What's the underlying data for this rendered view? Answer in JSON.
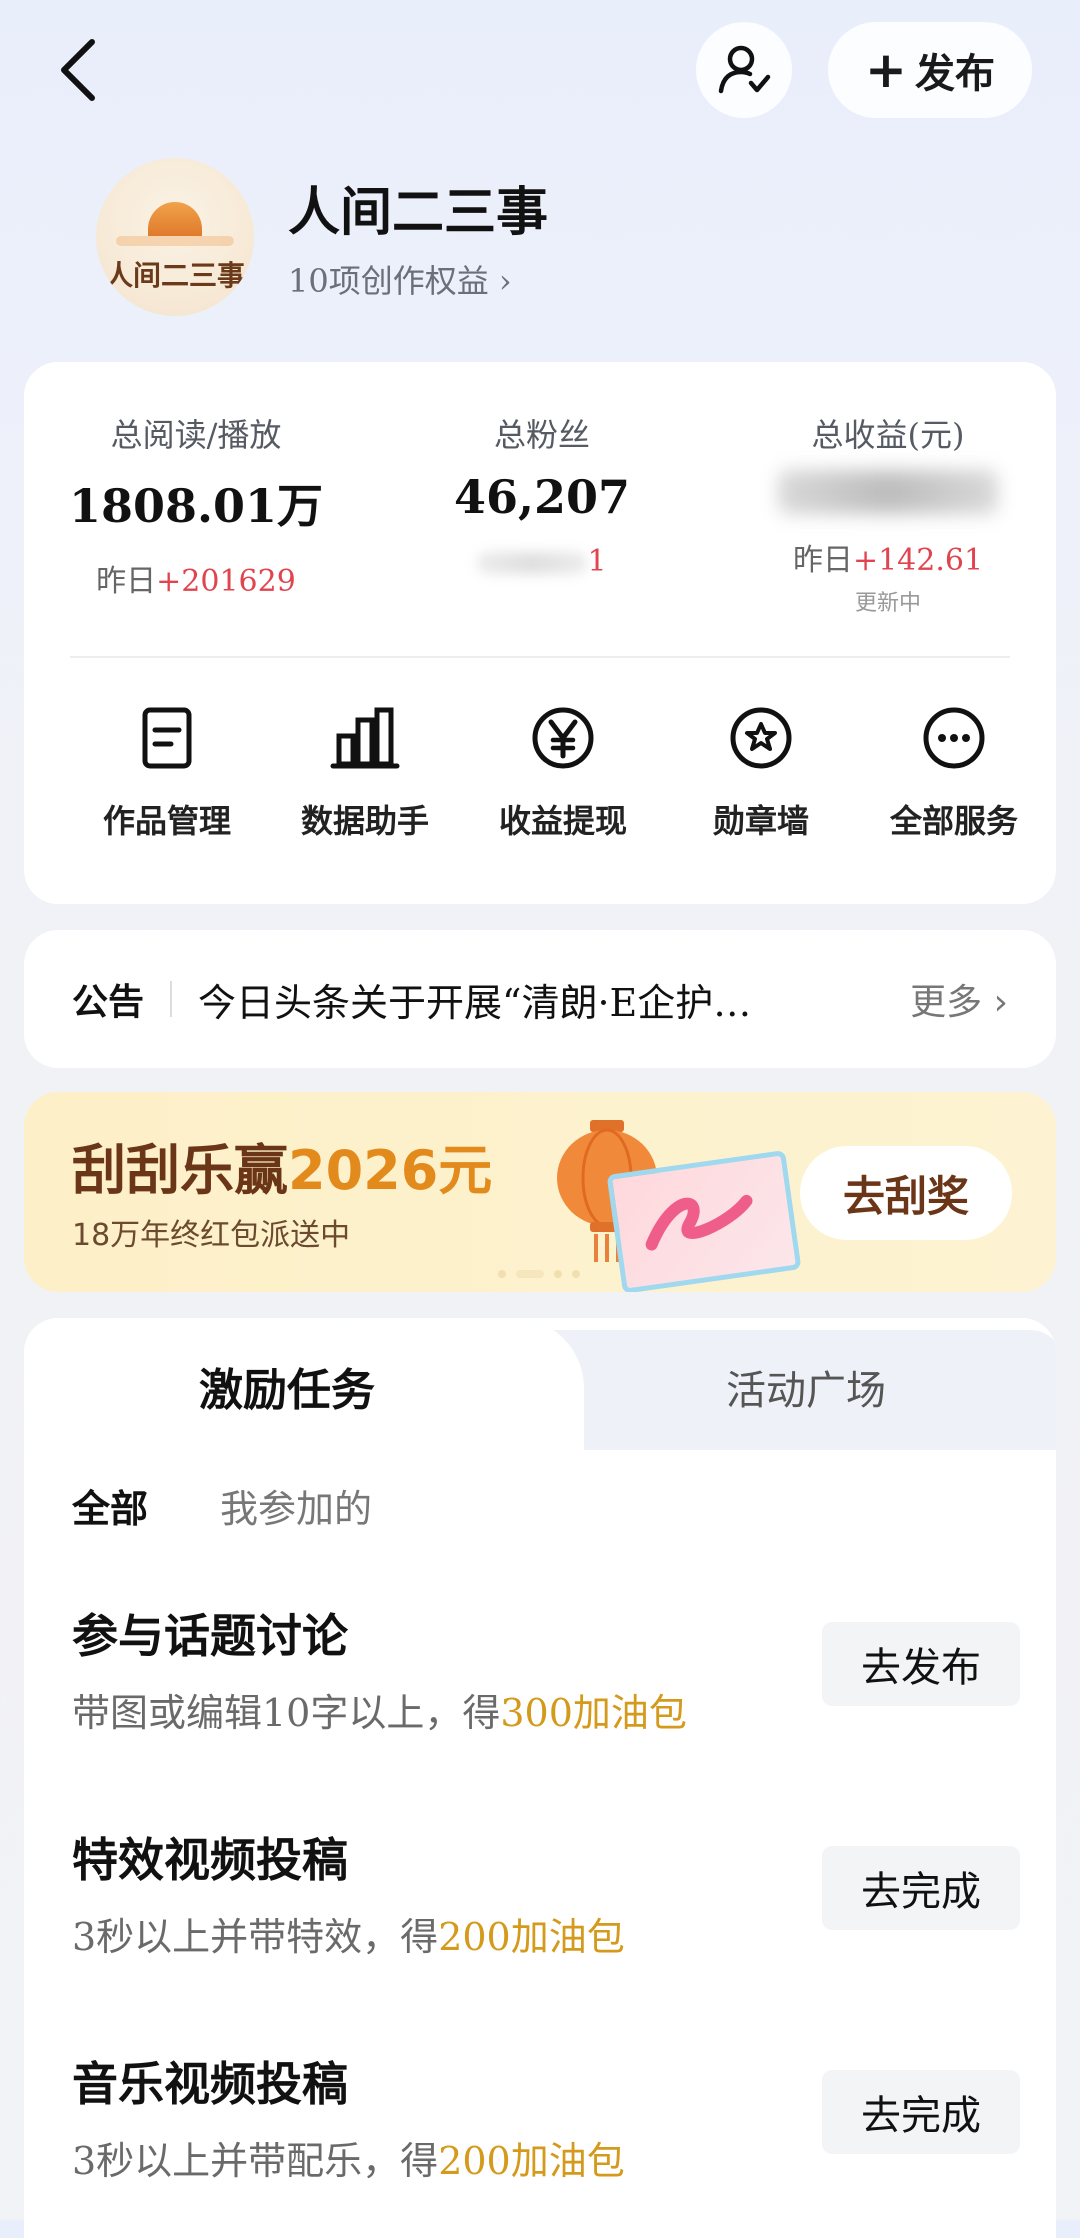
{
  "header": {
    "publish_label": "发布"
  },
  "profile": {
    "avatar_text": "人间二三事",
    "name": "人间二三事",
    "rights_text": "10项创作权益 ›"
  },
  "stats": [
    {
      "label": "总阅读/播放",
      "value": "1808.01万",
      "delta_prefix": "昨日",
      "delta_value": "+201629"
    },
    {
      "label": "总粉丝",
      "value": "46,207",
      "delta_value": "1"
    },
    {
      "label": "总收益(元)",
      "delta_prefix": "昨日",
      "delta_value": "+142.61",
      "note": "更新中"
    }
  ],
  "tools": [
    {
      "label": "作品管理",
      "icon": "document-icon"
    },
    {
      "label": "数据助手",
      "icon": "bar-chart-icon"
    },
    {
      "label": "收益提现",
      "icon": "yen-icon"
    },
    {
      "label": "勋章墙",
      "icon": "medal-icon"
    },
    {
      "label": "全部服务",
      "icon": "more-icon"
    }
  ],
  "notice": {
    "tag": "公告",
    "text": "今日头条关于开展“清朗·E企护…",
    "more": "更多 ›"
  },
  "banner": {
    "title_prefix": "刮刮乐赢",
    "title_highlight": "2026元",
    "subtitle": "18万年终红包派送中",
    "button": "去刮奖"
  },
  "tabs": [
    {
      "label": "激励任务"
    },
    {
      "label": "活动广场"
    }
  ],
  "filters": [
    {
      "label": "全部"
    },
    {
      "label": "我参加的"
    }
  ],
  "tasks": [
    {
      "title": "参与话题讨论",
      "desc": "带图或编辑10字以上，得",
      "reward": "300加油包",
      "button": "去发布"
    },
    {
      "title": "特效视频投稿",
      "desc": "3秒以上并带特效，得",
      "reward": "200加油包",
      "button": "去完成"
    },
    {
      "title": "音乐视频投稿",
      "desc": "3秒以上并带配乐，得",
      "reward": "200加油包",
      "button": "去完成"
    }
  ],
  "colors": {
    "accent_red": "#e0454f",
    "reward_gold": "#d49a1c",
    "banner_brown": "#6b3518"
  }
}
